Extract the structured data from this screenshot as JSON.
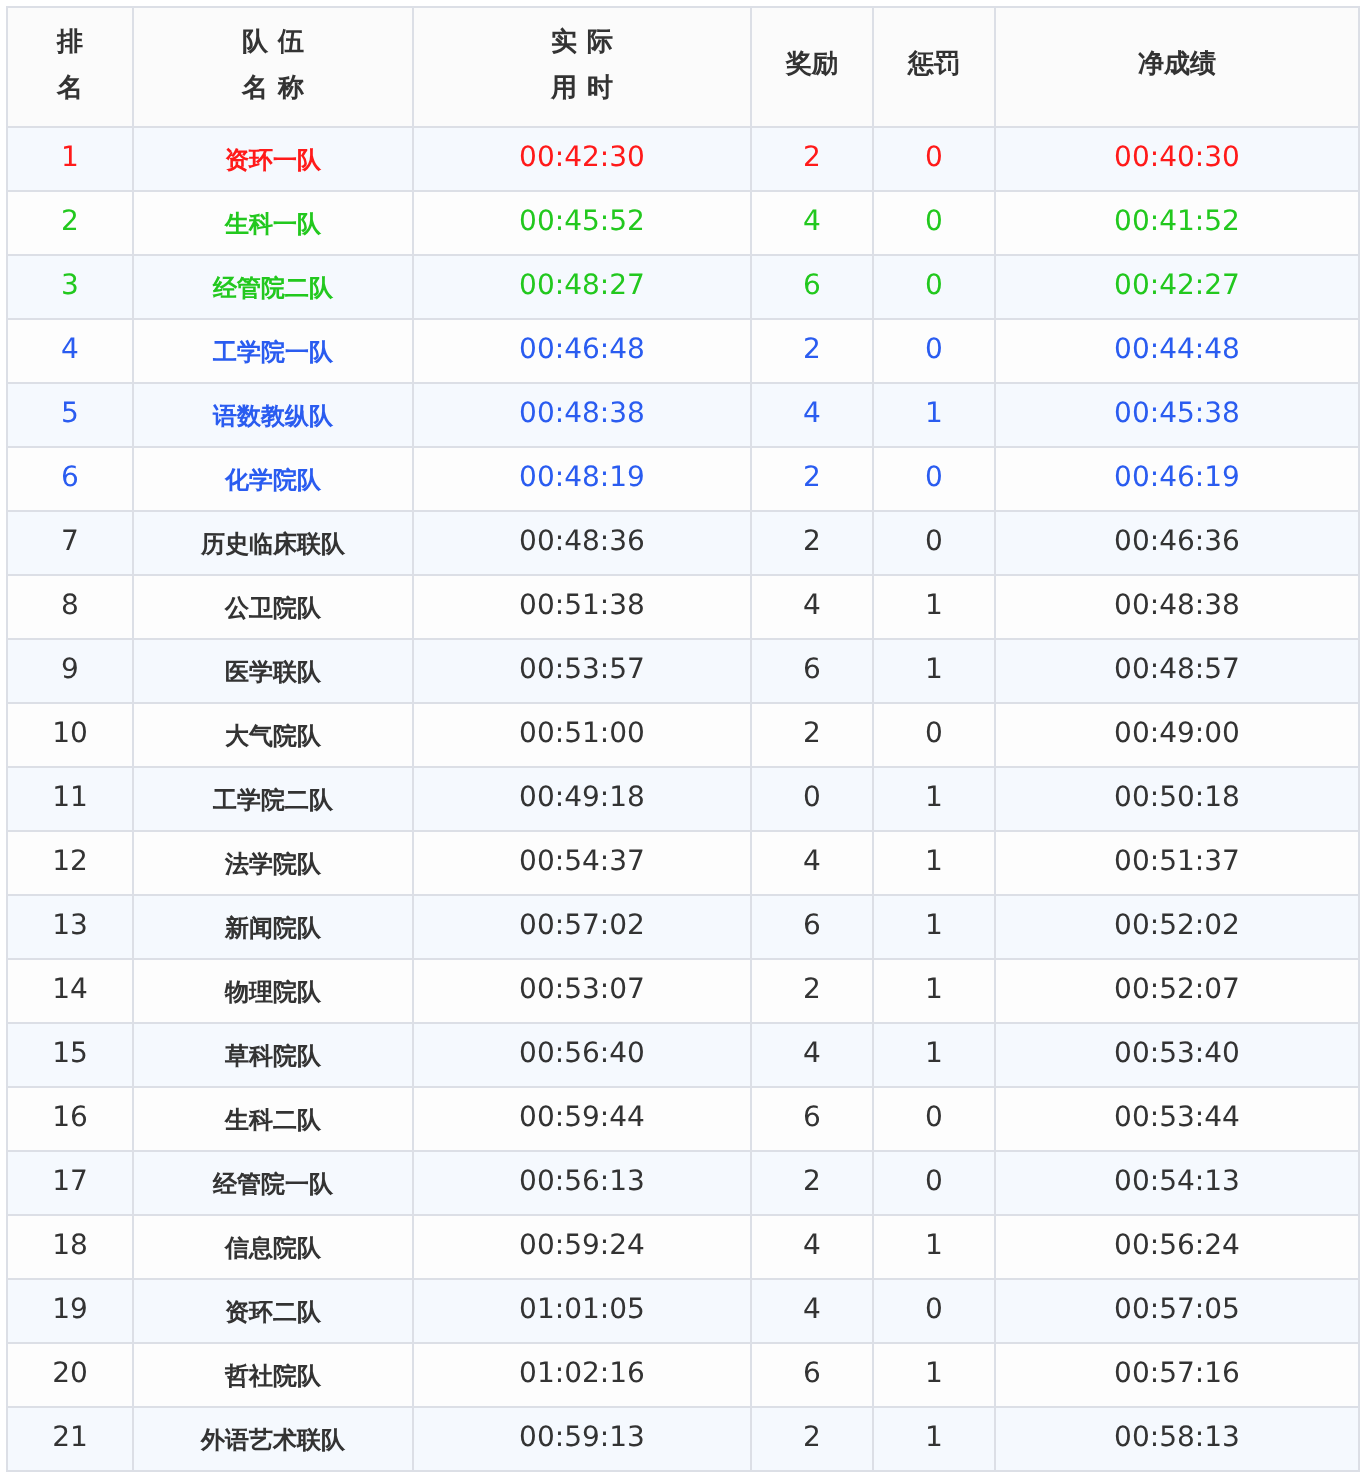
{
  "table": {
    "columns": [
      {
        "lines": [
          "排",
          "名"
        ]
      },
      {
        "lines": [
          "队 伍",
          "名 称"
        ]
      },
      {
        "lines": [
          "实 际",
          "用 时"
        ]
      },
      {
        "lines": [
          "奖励"
        ]
      },
      {
        "lines": [
          "惩罚"
        ]
      },
      {
        "lines": [
          "净成绩"
        ]
      }
    ],
    "rows": [
      {
        "rank": "1",
        "team": "资环一队",
        "time": "00:42:30",
        "bonus": "2",
        "penalty": "0",
        "net": "00:40:30",
        "color": "#ff1a1a"
      },
      {
        "rank": "2",
        "team": "生科一队",
        "time": "00:45:52",
        "bonus": "4",
        "penalty": "0",
        "net": "00:41:52",
        "color": "#22c81e"
      },
      {
        "rank": "3",
        "team": "经管院二队",
        "time": "00:48:27",
        "bonus": "6",
        "penalty": "0",
        "net": "00:42:27",
        "color": "#22c81e"
      },
      {
        "rank": "4",
        "team": "工学院一队",
        "time": "00:46:48",
        "bonus": "2",
        "penalty": "0",
        "net": "00:44:48",
        "color": "#2a5cf0"
      },
      {
        "rank": "5",
        "team": "语数教纵队",
        "time": "00:48:38",
        "bonus": "4",
        "penalty": "1",
        "net": "00:45:38",
        "color": "#2a5cf0"
      },
      {
        "rank": "6",
        "team": "化学院队",
        "time": "00:48:19",
        "bonus": "2",
        "penalty": "0",
        "net": "00:46:19",
        "color": "#2a5cf0"
      },
      {
        "rank": "7",
        "team": "历史临床联队",
        "time": "00:48:36",
        "bonus": "2",
        "penalty": "0",
        "net": "00:46:36",
        "color": "#333333"
      },
      {
        "rank": "8",
        "team": "公卫院队",
        "time": "00:51:38",
        "bonus": "4",
        "penalty": "1",
        "net": "00:48:38",
        "color": "#333333"
      },
      {
        "rank": "9",
        "team": "医学联队",
        "time": "00:53:57",
        "bonus": "6",
        "penalty": "1",
        "net": "00:48:57",
        "color": "#333333"
      },
      {
        "rank": "10",
        "team": "大气院队",
        "time": "00:51:00",
        "bonus": "2",
        "penalty": "0",
        "net": "00:49:00",
        "color": "#333333"
      },
      {
        "rank": "11",
        "team": "工学院二队",
        "time": "00:49:18",
        "bonus": "0",
        "penalty": "1",
        "net": "00:50:18",
        "color": "#333333"
      },
      {
        "rank": "12",
        "team": "法学院队",
        "time": "00:54:37",
        "bonus": "4",
        "penalty": "1",
        "net": "00:51:37",
        "color": "#333333"
      },
      {
        "rank": "13",
        "team": "新闻院队",
        "time": "00:57:02",
        "bonus": "6",
        "penalty": "1",
        "net": "00:52:02",
        "color": "#333333"
      },
      {
        "rank": "14",
        "team": "物理院队",
        "time": "00:53:07",
        "bonus": "2",
        "penalty": "1",
        "net": "00:52:07",
        "color": "#333333"
      },
      {
        "rank": "15",
        "team": "草科院队",
        "time": "00:56:40",
        "bonus": "4",
        "penalty": "1",
        "net": "00:53:40",
        "color": "#333333"
      },
      {
        "rank": "16",
        "team": "生科二队",
        "time": "00:59:44",
        "bonus": "6",
        "penalty": "0",
        "net": "00:53:44",
        "color": "#333333"
      },
      {
        "rank": "17",
        "team": "经管院一队",
        "time": "00:56:13",
        "bonus": "2",
        "penalty": "0",
        "net": "00:54:13",
        "color": "#333333"
      },
      {
        "rank": "18",
        "team": "信息院队",
        "time": "00:59:24",
        "bonus": "4",
        "penalty": "1",
        "net": "00:56:24",
        "color": "#333333"
      },
      {
        "rank": "19",
        "team": "资环二队",
        "time": "01:01:05",
        "bonus": "4",
        "penalty": "0",
        "net": "00:57:05",
        "color": "#333333"
      },
      {
        "rank": "20",
        "team": "哲社院队",
        "time": "01:02:16",
        "bonus": "6",
        "penalty": "1",
        "net": "00:57:16",
        "color": "#333333"
      },
      {
        "rank": "21",
        "team": "外语艺术联队",
        "time": "00:59:13",
        "bonus": "2",
        "penalty": "1",
        "net": "00:58:13",
        "color": "#333333"
      }
    ]
  }
}
